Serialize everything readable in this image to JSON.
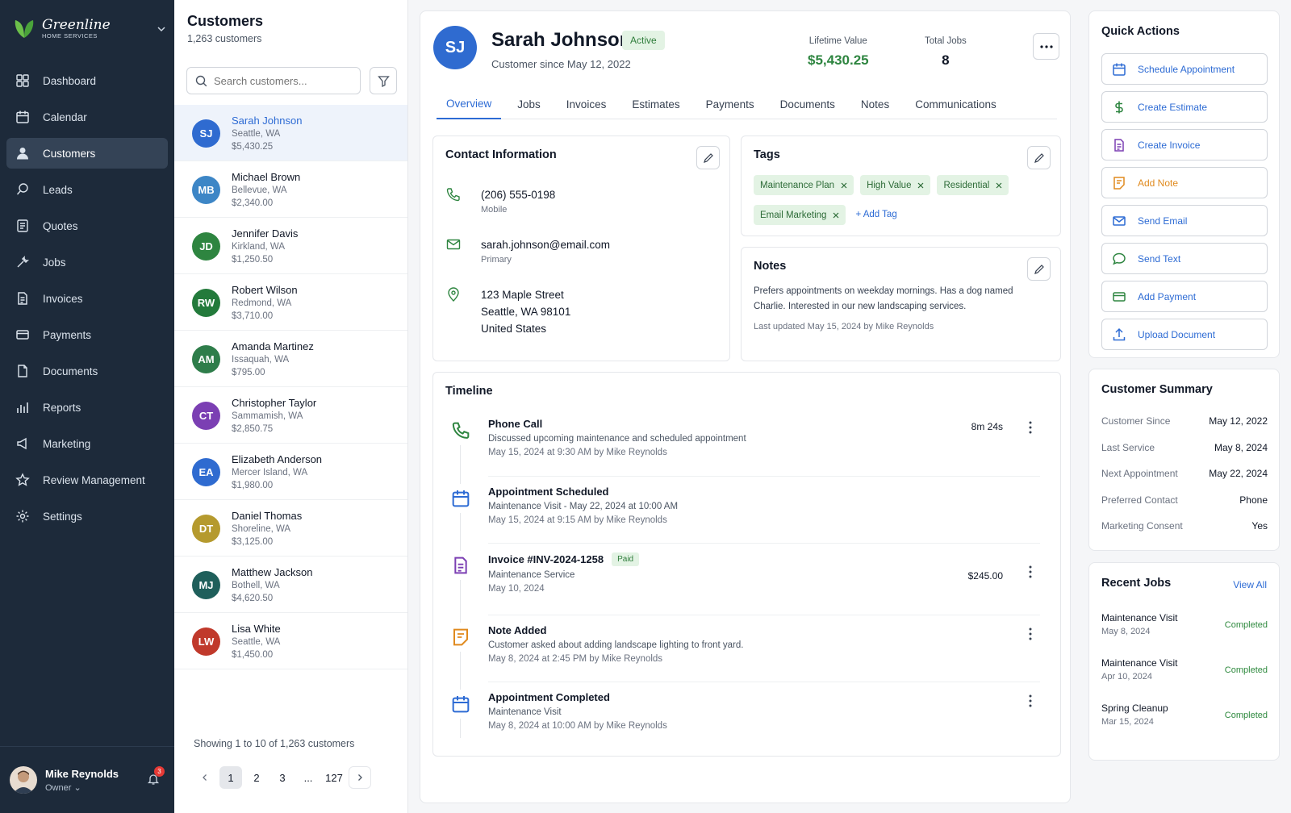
{
  "brand": {
    "name": "Greenline",
    "sub": "HOME SERVICES"
  },
  "nav": [
    {
      "label": "Dashboard",
      "icon": "grid-icon"
    },
    {
      "label": "Calendar",
      "icon": "calendar-icon"
    },
    {
      "label": "Customers",
      "icon": "user-icon",
      "active": true
    },
    {
      "label": "Leads",
      "icon": "magnet-icon"
    },
    {
      "label": "Quotes",
      "icon": "quote-icon"
    },
    {
      "label": "Jobs",
      "icon": "wrench-icon"
    },
    {
      "label": "Invoices",
      "icon": "invoice-icon"
    },
    {
      "label": "Payments",
      "icon": "card-icon"
    },
    {
      "label": "Documents",
      "icon": "document-icon"
    },
    {
      "label": "Reports",
      "icon": "chart-icon"
    },
    {
      "label": "Marketing",
      "icon": "megaphone-icon"
    },
    {
      "label": "Review Management",
      "icon": "star-icon"
    },
    {
      "label": "Settings",
      "icon": "gear-icon"
    }
  ],
  "user": {
    "name": "Mike Reynolds",
    "role": "Owner",
    "notifications": "3"
  },
  "list": {
    "title": "Customers",
    "count": "1,263 customers",
    "search_placeholder": "Search customers...",
    "customers": [
      {
        "initials": "SJ",
        "name": "Sarah Johnson",
        "loc": "Seattle, WA",
        "value": "$5,430.25",
        "color": "#2f6bd0",
        "selected": true
      },
      {
        "initials": "MB",
        "name": "Michael Brown",
        "loc": "Bellevue, WA",
        "value": "$2,340.00",
        "color": "#3d86c6"
      },
      {
        "initials": "JD",
        "name": "Jennifer Davis",
        "loc": "Kirkland, WA",
        "value": "$1,250.50",
        "color": "#2e8540"
      },
      {
        "initials": "RW",
        "name": "Robert Wilson",
        "loc": "Redmond, WA",
        "value": "$3,710.00",
        "color": "#237a3b"
      },
      {
        "initials": "AM",
        "name": "Amanda Martinez",
        "loc": "Issaquah, WA",
        "value": "$795.00",
        "color": "#2e7d4a"
      },
      {
        "initials": "CT",
        "name": "Christopher Taylor",
        "loc": "Sammamish, WA",
        "value": "$2,850.75",
        "color": "#7b3fb3"
      },
      {
        "initials": "EA",
        "name": "Elizabeth Anderson",
        "loc": "Mercer Island, WA",
        "value": "$1,980.00",
        "color": "#2f6bd0"
      },
      {
        "initials": "DT",
        "name": "Daniel Thomas",
        "loc": "Shoreline, WA",
        "value": "$3,125.00",
        "color": "#b59a2e"
      },
      {
        "initials": "MJ",
        "name": "Matthew Jackson",
        "loc": "Bothell, WA",
        "value": "$4,620.50",
        "color": "#1f5f5b"
      },
      {
        "initials": "LW",
        "name": "Lisa White",
        "loc": "Seattle, WA",
        "value": "$1,450.00",
        "color": "#c0392b"
      }
    ],
    "showing": "Showing 1 to 10 of 1,263 customers",
    "pages": [
      "1",
      "2",
      "3",
      "...",
      "127"
    ]
  },
  "customer": {
    "initials": "SJ",
    "name": "Sarah Johnson",
    "status": "Active",
    "since": "Customer since May 12, 2022",
    "lifetime_label": "Lifetime Value",
    "lifetime": "$5,430.25",
    "jobs_label": "Total Jobs",
    "jobs": "8",
    "tabs": [
      "Overview",
      "Jobs",
      "Invoices",
      "Estimates",
      "Payments",
      "Documents",
      "Notes",
      "Communications"
    ]
  },
  "contact": {
    "title": "Contact Information",
    "phone": "(206) 555-0198",
    "phone_type": "Mobile",
    "email": "sarah.johnson@email.com",
    "email_type": "Primary",
    "address": [
      "123 Maple Street",
      "Seattle, WA 98101",
      "United States"
    ]
  },
  "tags": {
    "title": "Tags",
    "items": [
      "Maintenance Plan",
      "High Value",
      "Residential",
      "Email Marketing"
    ],
    "add": "+ Add Tag"
  },
  "notes": {
    "title": "Notes",
    "text": "Prefers appointments on weekday mornings. Has a dog named Charlie. Interested in our new landscaping services.",
    "updated": "Last updated May 15, 2024 by Mike Reynolds"
  },
  "timeline": {
    "title": "Timeline",
    "items": [
      {
        "title": "Phone Call",
        "sub": "Discussed upcoming maintenance and scheduled appointment",
        "meta": "May 15, 2024 at 9:30 AM by Mike Reynolds",
        "right": "8m 24s",
        "icon": "phone-icon",
        "color": "#2e8540"
      },
      {
        "title": "Appointment Scheduled",
        "sub": "Maintenance Visit - May 22, 2024 at 10:00 AM",
        "meta": "May 15, 2024 at 9:15 AM by Mike Reynolds",
        "right": "",
        "icon": "calendar-icon",
        "color": "#2d6bd4"
      },
      {
        "title": "Invoice #INV-2024-1258",
        "badge": "Paid",
        "sub": "Maintenance Service",
        "meta": "May 10, 2024",
        "right": "$245.00",
        "icon": "invoice-icon",
        "color": "#7b3fb3"
      },
      {
        "title": "Note Added",
        "sub": "Customer asked about adding landscape lighting to front yard.",
        "meta": "May 8, 2024 at 2:45 PM by Mike Reynolds",
        "right": "",
        "icon": "note-icon",
        "color": "#e08a1e"
      },
      {
        "title": "Appointment Completed",
        "sub": "Maintenance Visit",
        "meta": "May 8, 2024 at 10:00 AM by Mike Reynolds",
        "right": "",
        "icon": "calendar-icon",
        "color": "#2d6bd4"
      }
    ]
  },
  "quick": {
    "title": "Quick Actions",
    "items": [
      {
        "label": "Schedule Appointment",
        "icon": "calendar-icon",
        "color": "#2d6bd4"
      },
      {
        "label": "Create Estimate",
        "icon": "dollar-icon",
        "color": "#2e8540"
      },
      {
        "label": "Create Invoice",
        "icon": "invoice-icon",
        "color": "#7b3fb3"
      },
      {
        "label": "Add Note",
        "icon": "note-icon",
        "color": "#e08a1e"
      },
      {
        "label": "Send Email",
        "icon": "mail-icon",
        "color": "#2d6bd4"
      },
      {
        "label": "Send Text",
        "icon": "chat-icon",
        "color": "#2e8540"
      },
      {
        "label": "Add Payment",
        "icon": "card-icon",
        "color": "#2e8540"
      },
      {
        "label": "Upload Document",
        "icon": "upload-icon",
        "color": "#2d6bd4"
      }
    ]
  },
  "summary": {
    "title": "Customer Summary",
    "items": [
      {
        "k": "Customer Since",
        "v": "May 12, 2022"
      },
      {
        "k": "Last Service",
        "v": "May 8, 2024"
      },
      {
        "k": "Next Appointment",
        "v": "May 22, 2024"
      },
      {
        "k": "Preferred Contact",
        "v": "Phone"
      },
      {
        "k": "Marketing Consent",
        "v": "Yes"
      }
    ]
  },
  "recent": {
    "title": "Recent Jobs",
    "view_all": "View All",
    "items": [
      {
        "name": "Maintenance Visit",
        "date": "May 8, 2024",
        "status": "Completed"
      },
      {
        "name": "Maintenance Visit",
        "date": "Apr 10, 2024",
        "status": "Completed"
      },
      {
        "name": "Spring Cleanup",
        "date": "Mar 15, 2024",
        "status": "Completed"
      }
    ]
  }
}
